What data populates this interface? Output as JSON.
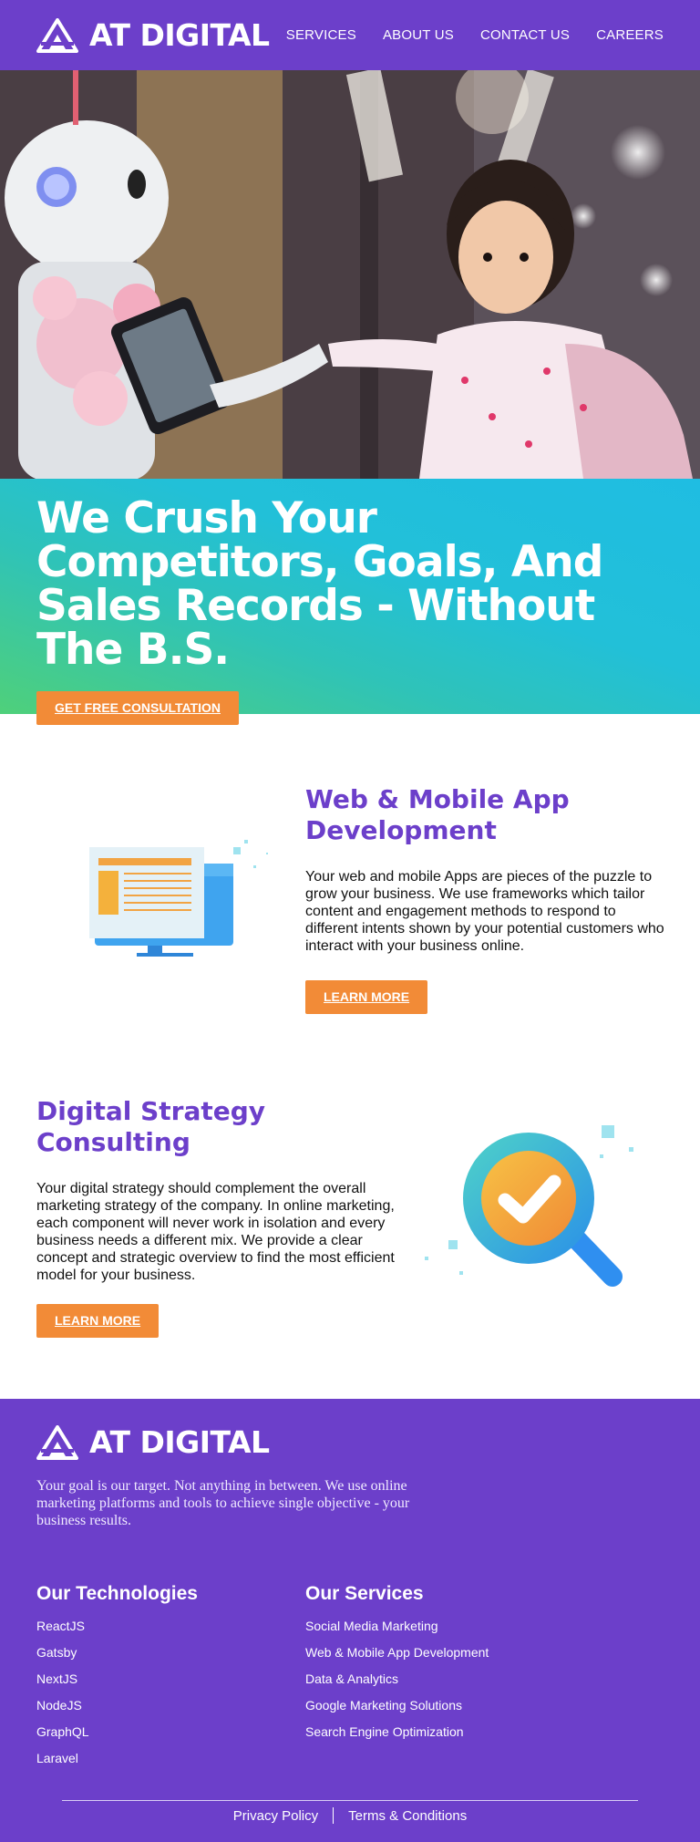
{
  "header": {
    "brand": "AT DIGITAL",
    "nav": [
      "SERVICES",
      "ABOUT US",
      "CONTACT US",
      "CAREERS"
    ]
  },
  "hero": {
    "headline": "We Crush Your Competitors, Goals, And Sales Records - Without The B.S.",
    "cta": "GET FREE CONSULTATION"
  },
  "services": [
    {
      "title": "Web & Mobile App Development",
      "text": "Your web and mobile Apps are pieces of the puzzle to grow your business. We use frameworks which tailor content and engagement methods to respond to different intents shown by your potential customers who interact with your business online.",
      "button": "LEARN MORE",
      "icon": "monitor-icon"
    },
    {
      "title": "Digital Strategy Consulting",
      "text": "Your digital strategy should complement the overall marketing strategy of the company. In online marketing, each component will never work in isolation and every business needs a different mix. We provide a clear concept and strategic overview to find the most efficient model for your business.",
      "button": "LEARN MORE",
      "icon": "magnifier-check-icon"
    }
  ],
  "footer": {
    "brand": "AT DIGITAL",
    "tagline": "Your goal is our target. Not anything in between. We use online marketing platforms and tools to achieve single objective - your business results.",
    "technologies": {
      "title": "Our Technologies",
      "items": [
        "ReactJS",
        "Gatsby",
        "NextJS",
        "NodeJS",
        "GraphQL",
        "Laravel"
      ]
    },
    "services": {
      "title": "Our Services",
      "items": [
        "Social Media Marketing",
        "Web & Mobile App Development",
        "Data & Analytics",
        "Google Marketing Solutions",
        "Search Engine Optimization"
      ]
    },
    "legal": [
      "Privacy Policy",
      "Terms & Conditions"
    ]
  },
  "colors": {
    "brand_purple": "#6c3fca",
    "cta_orange": "#f28b37",
    "banner_green": "#4fd07a",
    "banner_cyan": "#1fbde2"
  }
}
